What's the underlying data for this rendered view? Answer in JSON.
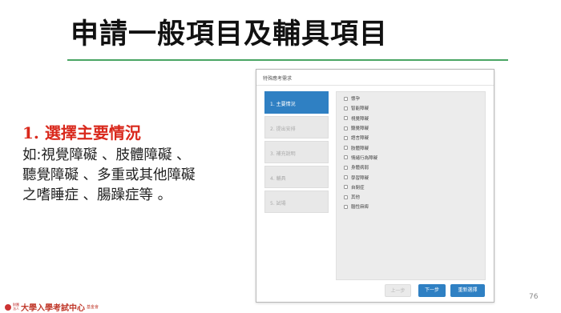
{
  "slide": {
    "title": "申請一般項目及輔具項目",
    "section_heading": "1. 選擇主要情況",
    "section_body": [
      "如:視覺障礙 、肢體障礙 、",
      "聽覺障礙 、多重或其他障礙",
      "之嗜睡症 、腸躁症等 。"
    ],
    "page_number": "76",
    "footer": {
      "org_small": [
        "財團",
        "法人"
      ],
      "org_name": "大學入學考試中心",
      "org_suffix": "基金會"
    }
  },
  "dialog": {
    "header": "特殊應考需求",
    "steps": [
      {
        "label": "1. 主要情況",
        "active": true
      },
      {
        "label": "2. 提出安排",
        "active": false
      },
      {
        "label": "3. 補充說明",
        "active": false
      },
      {
        "label": "4. 輔具",
        "active": false
      },
      {
        "label": "5. 試場",
        "active": false
      }
    ],
    "options": [
      "懷孕",
      "智能障礙",
      "視覺障礙",
      "聽覺障礙",
      "語言障礙",
      "肢體障礙",
      "情緒行為障礙",
      "身體病弱",
      "學習障礙",
      "自閉症",
      "其他",
      "腦性麻痺"
    ],
    "buttons": {
      "prev": "上一步",
      "next": "下一步",
      "reset": "重新選擇"
    }
  },
  "colors": {
    "accent_blue": "#2f80c3",
    "heading_red": "#d9281c",
    "rule_green": "#4aa564"
  }
}
